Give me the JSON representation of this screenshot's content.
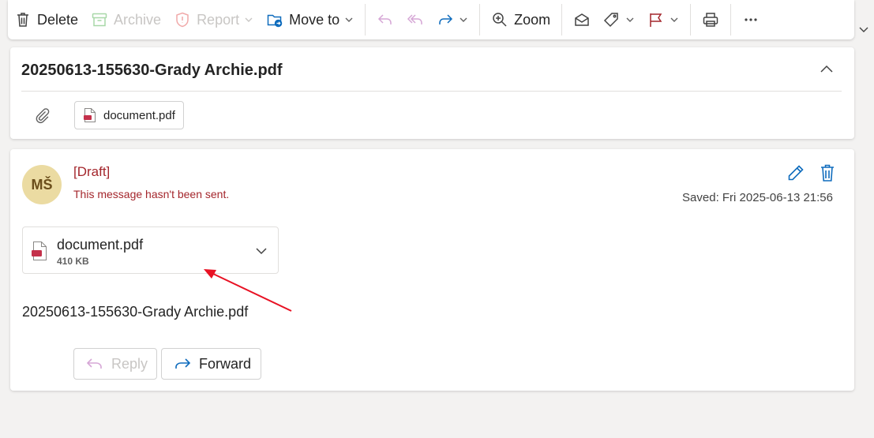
{
  "toolbar": {
    "delete_label": "Delete",
    "archive_label": "Archive",
    "report_label": "Report",
    "move_to_label": "Move to",
    "zoom_label": "Zoom",
    "icons": [
      "trash-icon",
      "archive-icon",
      "shield-icon",
      "folder-move-icon",
      "reply-icon",
      "reply-all-icon",
      "forward-icon",
      "zoom-icon",
      "envelope-open-icon",
      "tag-icon",
      "flag-icon",
      "print-icon",
      "more-icon"
    ]
  },
  "attachment_header": {
    "title": "20250613-155630-Grady Archie.pdf",
    "chip_label": "document.pdf"
  },
  "message": {
    "avatar_initials": "MŠ",
    "draft_label": "[Draft]",
    "draft_note": "This message hasn't been sent.",
    "saved": "Saved: Fri 2025-06-13 21:56",
    "attachment": {
      "name": "document.pdf",
      "size": "410 KB"
    },
    "body": "20250613-155630-Grady Archie.pdf",
    "reply_label": "Reply",
    "forward_label": "Forward"
  },
  "colors": {
    "accent_blue": "#0f6cbd",
    "draft_red": "#a4262c",
    "avatar_bg": "#ebdba2",
    "pdf_red": "#c4314b",
    "annotation_red": "#e81123"
  }
}
